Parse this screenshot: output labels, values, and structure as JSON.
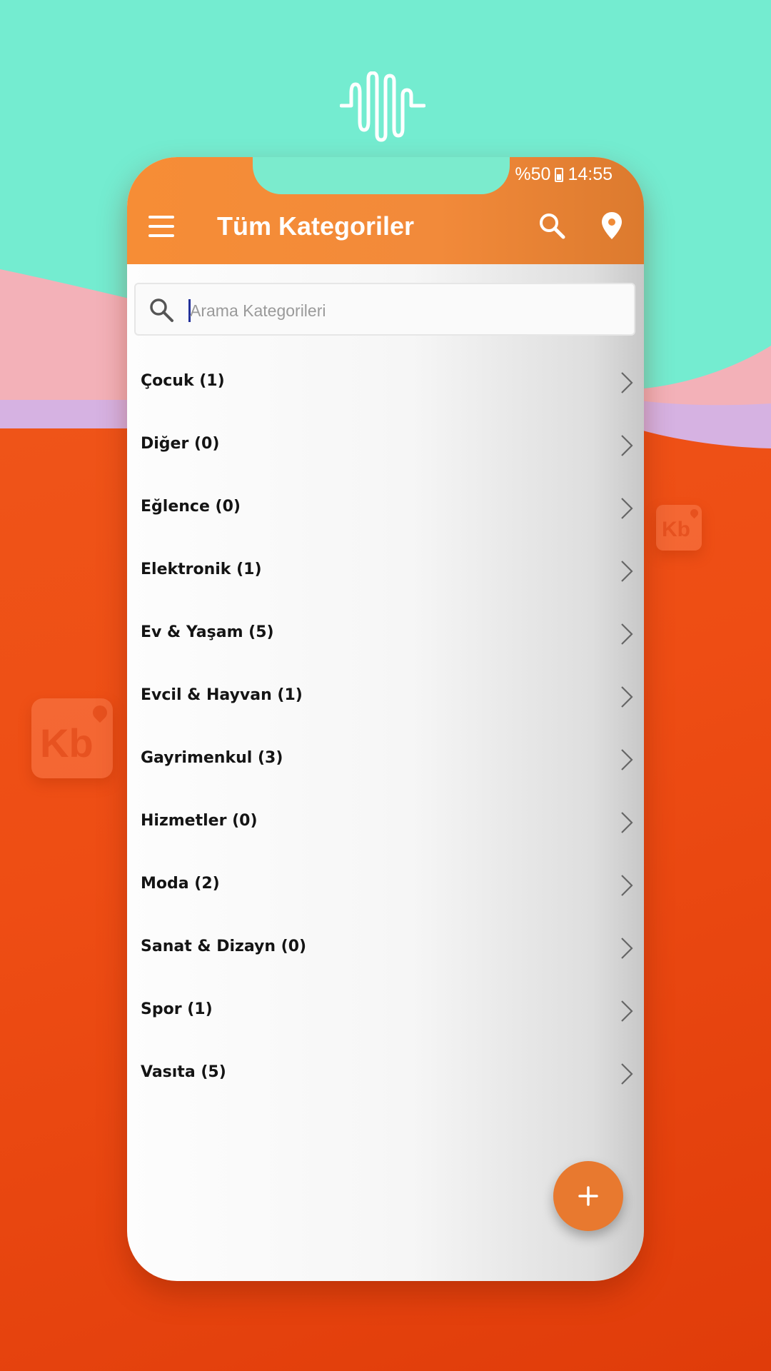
{
  "status_bar": {
    "battery": "%50",
    "time": "14:55"
  },
  "appbar": {
    "title": "Tüm Kategoriler"
  },
  "search": {
    "placeholder": "Arama Kategorileri",
    "value": ""
  },
  "categories": [
    {
      "label": "Çocuk (1)"
    },
    {
      "label": "Diğer (0)"
    },
    {
      "label": "Eğlence (0)"
    },
    {
      "label": "Elektronik (1)"
    },
    {
      "label": "Ev & Yaşam (5)"
    },
    {
      "label": "Evcil & Hayvan (1)"
    },
    {
      "label": "Gayrimenkul (3)"
    },
    {
      "label": "Hizmetler (0)"
    },
    {
      "label": "Moda (2)"
    },
    {
      "label": "Sanat & Dizayn (0)"
    },
    {
      "label": "Spor (1)"
    },
    {
      "label": "Vasıta (5)"
    }
  ],
  "badges": {
    "logo_text": "Kb"
  },
  "icons": [
    "menu-icon",
    "search-icon",
    "location-pin-icon",
    "chevron-right-icon",
    "plus-icon",
    "sound-wave-icon"
  ],
  "colors": {
    "appbar": "#f68d36",
    "fab": "#e8792f",
    "mint": "#72ecd0",
    "orange_bg": "#ee4d14"
  }
}
